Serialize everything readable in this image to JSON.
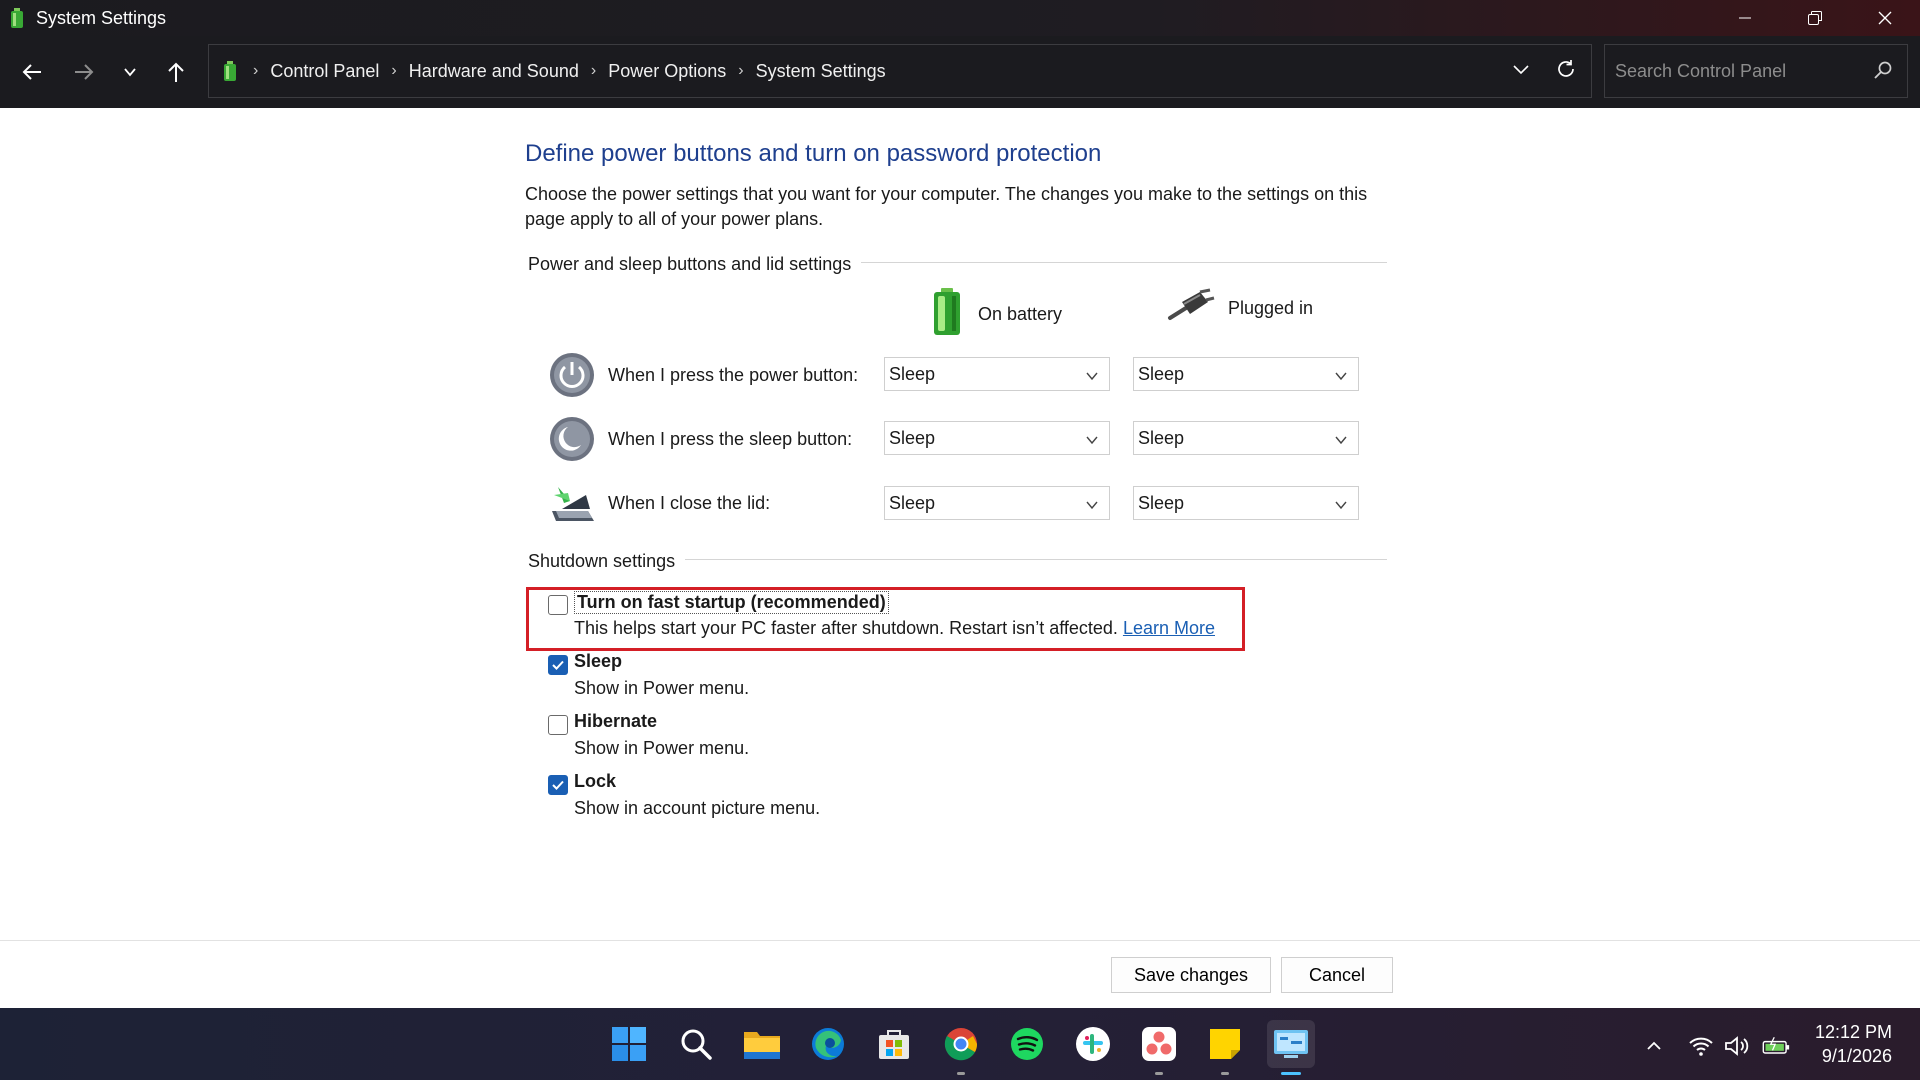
{
  "window": {
    "title": "System Settings"
  },
  "address_bar": {
    "breadcrumbs": [
      "Control Panel",
      "Hardware and Sound",
      "Power Options",
      "System Settings"
    ],
    "search_placeholder": "Search Control Panel"
  },
  "page": {
    "heading": "Define power buttons and turn on password protection",
    "description": "Choose the power settings that you want for your computer. The changes you make to the settings on this page apply to all of your power plans.",
    "power_group_label": "Power and sleep buttons and lid settings",
    "columns": {
      "battery": "On battery",
      "plugged": "Plugged in"
    },
    "rows": [
      {
        "label": "When I press the power button:",
        "battery": "Sleep",
        "plugged": "Sleep",
        "icon": "power-button-icon"
      },
      {
        "label": "When I press the sleep button:",
        "battery": "Sleep",
        "plugged": "Sleep",
        "icon": "sleep-button-icon"
      },
      {
        "label": "When I close the lid:",
        "battery": "Sleep",
        "plugged": "Sleep",
        "icon": "laptop-lid-icon"
      }
    ],
    "shutdown_group_label": "Shutdown settings",
    "shutdown_options": [
      {
        "title": "Turn on fast startup (recommended)",
        "subtitle": "This helps start your PC faster after shutdown. Restart isn’t affected.",
        "link": "Learn More",
        "checked": false
      },
      {
        "title": "Sleep",
        "subtitle": "Show in Power menu.",
        "checked": true
      },
      {
        "title": "Hibernate",
        "subtitle": "Show in Power menu.",
        "checked": false
      },
      {
        "title": "Lock",
        "subtitle": "Show in account picture menu.",
        "checked": true
      }
    ],
    "save_label": "Save changes",
    "cancel_label": "Cancel"
  },
  "taskbar": {
    "apps": [
      "start-icon",
      "search-icon",
      "file-explorer-icon",
      "edge-icon",
      "microsoft-store-icon",
      "chrome-icon",
      "spotify-icon",
      "slack-icon",
      "asana-icon",
      "sticky-notes-icon",
      "control-panel-icon"
    ],
    "time": "12:12 PM",
    "date": "9/1/2026"
  },
  "colors": {
    "heading": "#1e3f8e",
    "link": "#1a5fb4",
    "highlight_border": "#d41f26",
    "checkbox_checked": "#1a5fb4"
  }
}
